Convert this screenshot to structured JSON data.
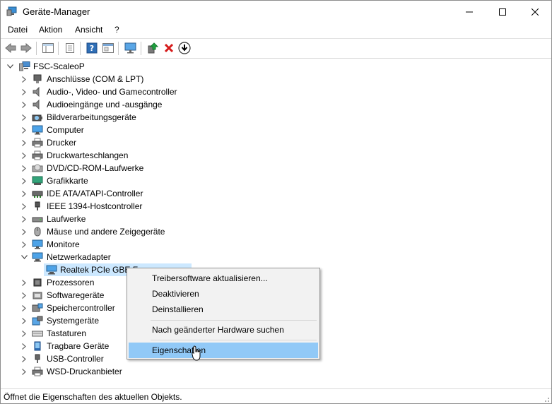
{
  "window": {
    "title": "Geräte-Manager"
  },
  "menubar": {
    "items": [
      "Datei",
      "Aktion",
      "Ansicht",
      "?"
    ]
  },
  "tree": {
    "root": "FSC-ScaleoP",
    "categories": [
      {
        "label": "Anschlüsse (COM & LPT)",
        "icon": "port-icon"
      },
      {
        "label": "Audio-, Video- und Gamecontroller",
        "icon": "speaker-icon"
      },
      {
        "label": "Audioeingänge und -ausgänge",
        "icon": "speaker-icon"
      },
      {
        "label": "Bildverarbeitungsgeräte",
        "icon": "camera-icon"
      },
      {
        "label": "Computer",
        "icon": "monitor-icon"
      },
      {
        "label": "Drucker",
        "icon": "printer-icon"
      },
      {
        "label": "Druckwarteschlangen",
        "icon": "printer-icon"
      },
      {
        "label": "DVD/CD-ROM-Laufwerke",
        "icon": "disc-icon"
      },
      {
        "label": "Grafikkarte",
        "icon": "display-adapter-icon"
      },
      {
        "label": "IDE ATA/ATAPI-Controller",
        "icon": "controller-icon"
      },
      {
        "label": "IEEE 1394-Hostcontroller",
        "icon": "plug-icon"
      },
      {
        "label": "Laufwerke",
        "icon": "drive-icon"
      },
      {
        "label": "Mäuse und andere Zeigegeräte",
        "icon": "mouse-icon"
      },
      {
        "label": "Monitore",
        "icon": "monitor-icon"
      },
      {
        "label": "Netzwerkadapter",
        "icon": "network-icon",
        "expanded": true
      },
      {
        "label": "Prozessoren",
        "icon": "chip-icon"
      },
      {
        "label": "Softwaregeräte",
        "icon": "software-device-icon"
      },
      {
        "label": "Speichercontroller",
        "icon": "storage-controller-icon"
      },
      {
        "label": "Systemgeräte",
        "icon": "system-device-icon"
      },
      {
        "label": "Tastaturen",
        "icon": "keyboard-icon"
      },
      {
        "label": "Tragbare Geräte",
        "icon": "portable-device-icon"
      },
      {
        "label": "USB-Controller",
        "icon": "usb-icon"
      },
      {
        "label": "WSD-Druckanbieter",
        "icon": "printer-icon"
      }
    ],
    "network_child": "Realtek PCIe GBE F"
  },
  "context_menu": {
    "items": [
      "Treibersoftware aktualisieren...",
      "Deaktivieren",
      "Deinstallieren",
      "Nach geänderter Hardware suchen",
      "Eigenschaften"
    ]
  },
  "statusbar": {
    "text": "Öffnet die Eigenschaften des aktuellen Objekts."
  },
  "colors": {
    "selection": "#cce8ff",
    "menu_highlight": "#91c9f7",
    "accent": "#1e7fd8"
  }
}
